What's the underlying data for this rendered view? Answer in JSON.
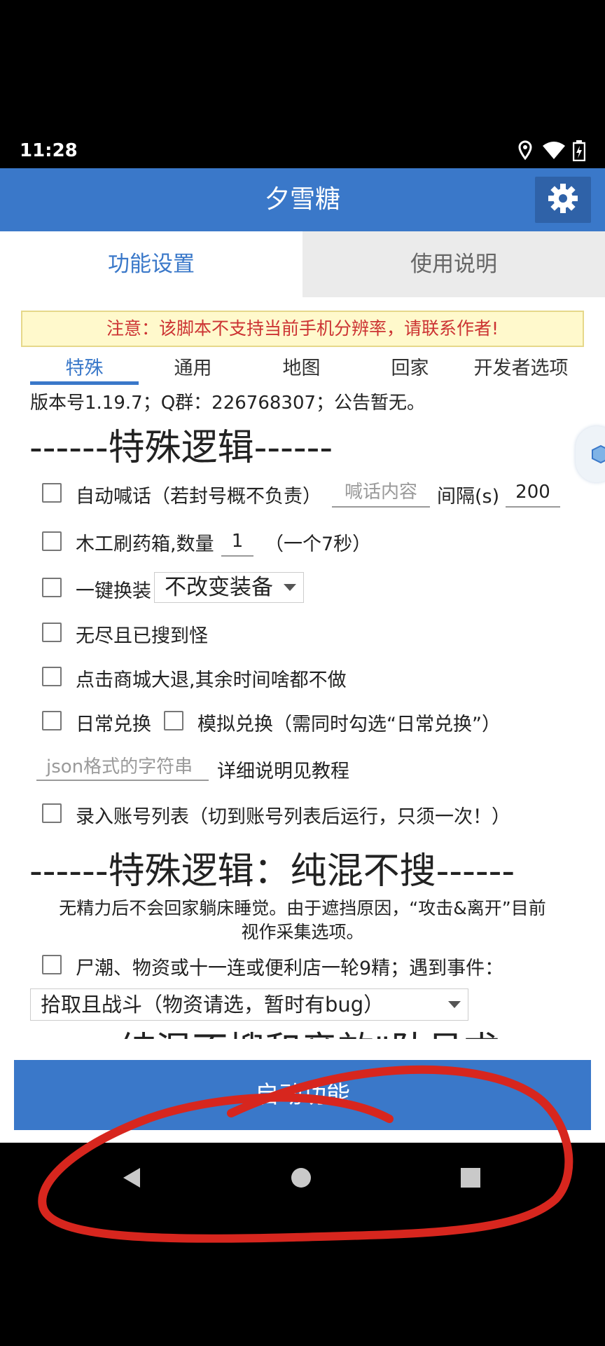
{
  "status": {
    "time": "11:28"
  },
  "app": {
    "title": "夕雪糖"
  },
  "top_tabs": [
    {
      "label": "功能设置",
      "active": true
    },
    {
      "label": "使用说明",
      "active": false
    }
  ],
  "notice": "注意：该脚本不支持当前手机分辨率，请联系作者!",
  "sub_tabs": [
    "特殊",
    "通用",
    "地图",
    "回家",
    "开发者选项"
  ],
  "version_line": "版本号1.19.7；Q群：226768307；公告暂无。",
  "section1_title": "------特殊逻辑------",
  "rows": {
    "auto_shout": {
      "label": "自动喊话（若封号概不负责）",
      "input_placeholder": "喊话内容",
      "interval_label": "间隔(s)",
      "interval_value": "200"
    },
    "carpenter": {
      "label": "木工刷药箱,数量",
      "qty_value": "1",
      "suffix": "（一个7秒）"
    },
    "one_key": {
      "label": "一键换装",
      "select_value": "不改变装备"
    },
    "endless": {
      "label": "无尽且已搜到怪"
    },
    "mall": {
      "label": "点击商城大退,其余时间啥都不做"
    },
    "daily": {
      "label": "日常兑换",
      "sim_label": "模拟兑换（需同时勾选“日常兑换”）"
    },
    "json": {
      "placeholder": "json格式的字符串",
      "note": "详细说明见教程"
    },
    "account": {
      "label": "录入账号列表（切到账号列表后运行，只须一次！）"
    }
  },
  "section2_title": "------特殊逻辑：纯混不搜------",
  "section2_desc_1": "无精力后不会回家躺床睡觉。由于遮挡原因，“攻击&离开”目前",
  "section2_desc_2": "视作采集选项。",
  "corpse": {
    "label": "尸潮、物资或十一连或便利店一轮9精；遇到事件：",
    "select_value": "拾取且战斗（物资请选，暂时有bug）"
  },
  "cut_line": "纯混不搜和音效\"队员求",
  "start_button": "启动功能",
  "colors": {
    "primary": "#3a78c9",
    "notice_bg": "#fff9cc",
    "notice_text": "#cc3333",
    "annotation": "#d7261e"
  }
}
